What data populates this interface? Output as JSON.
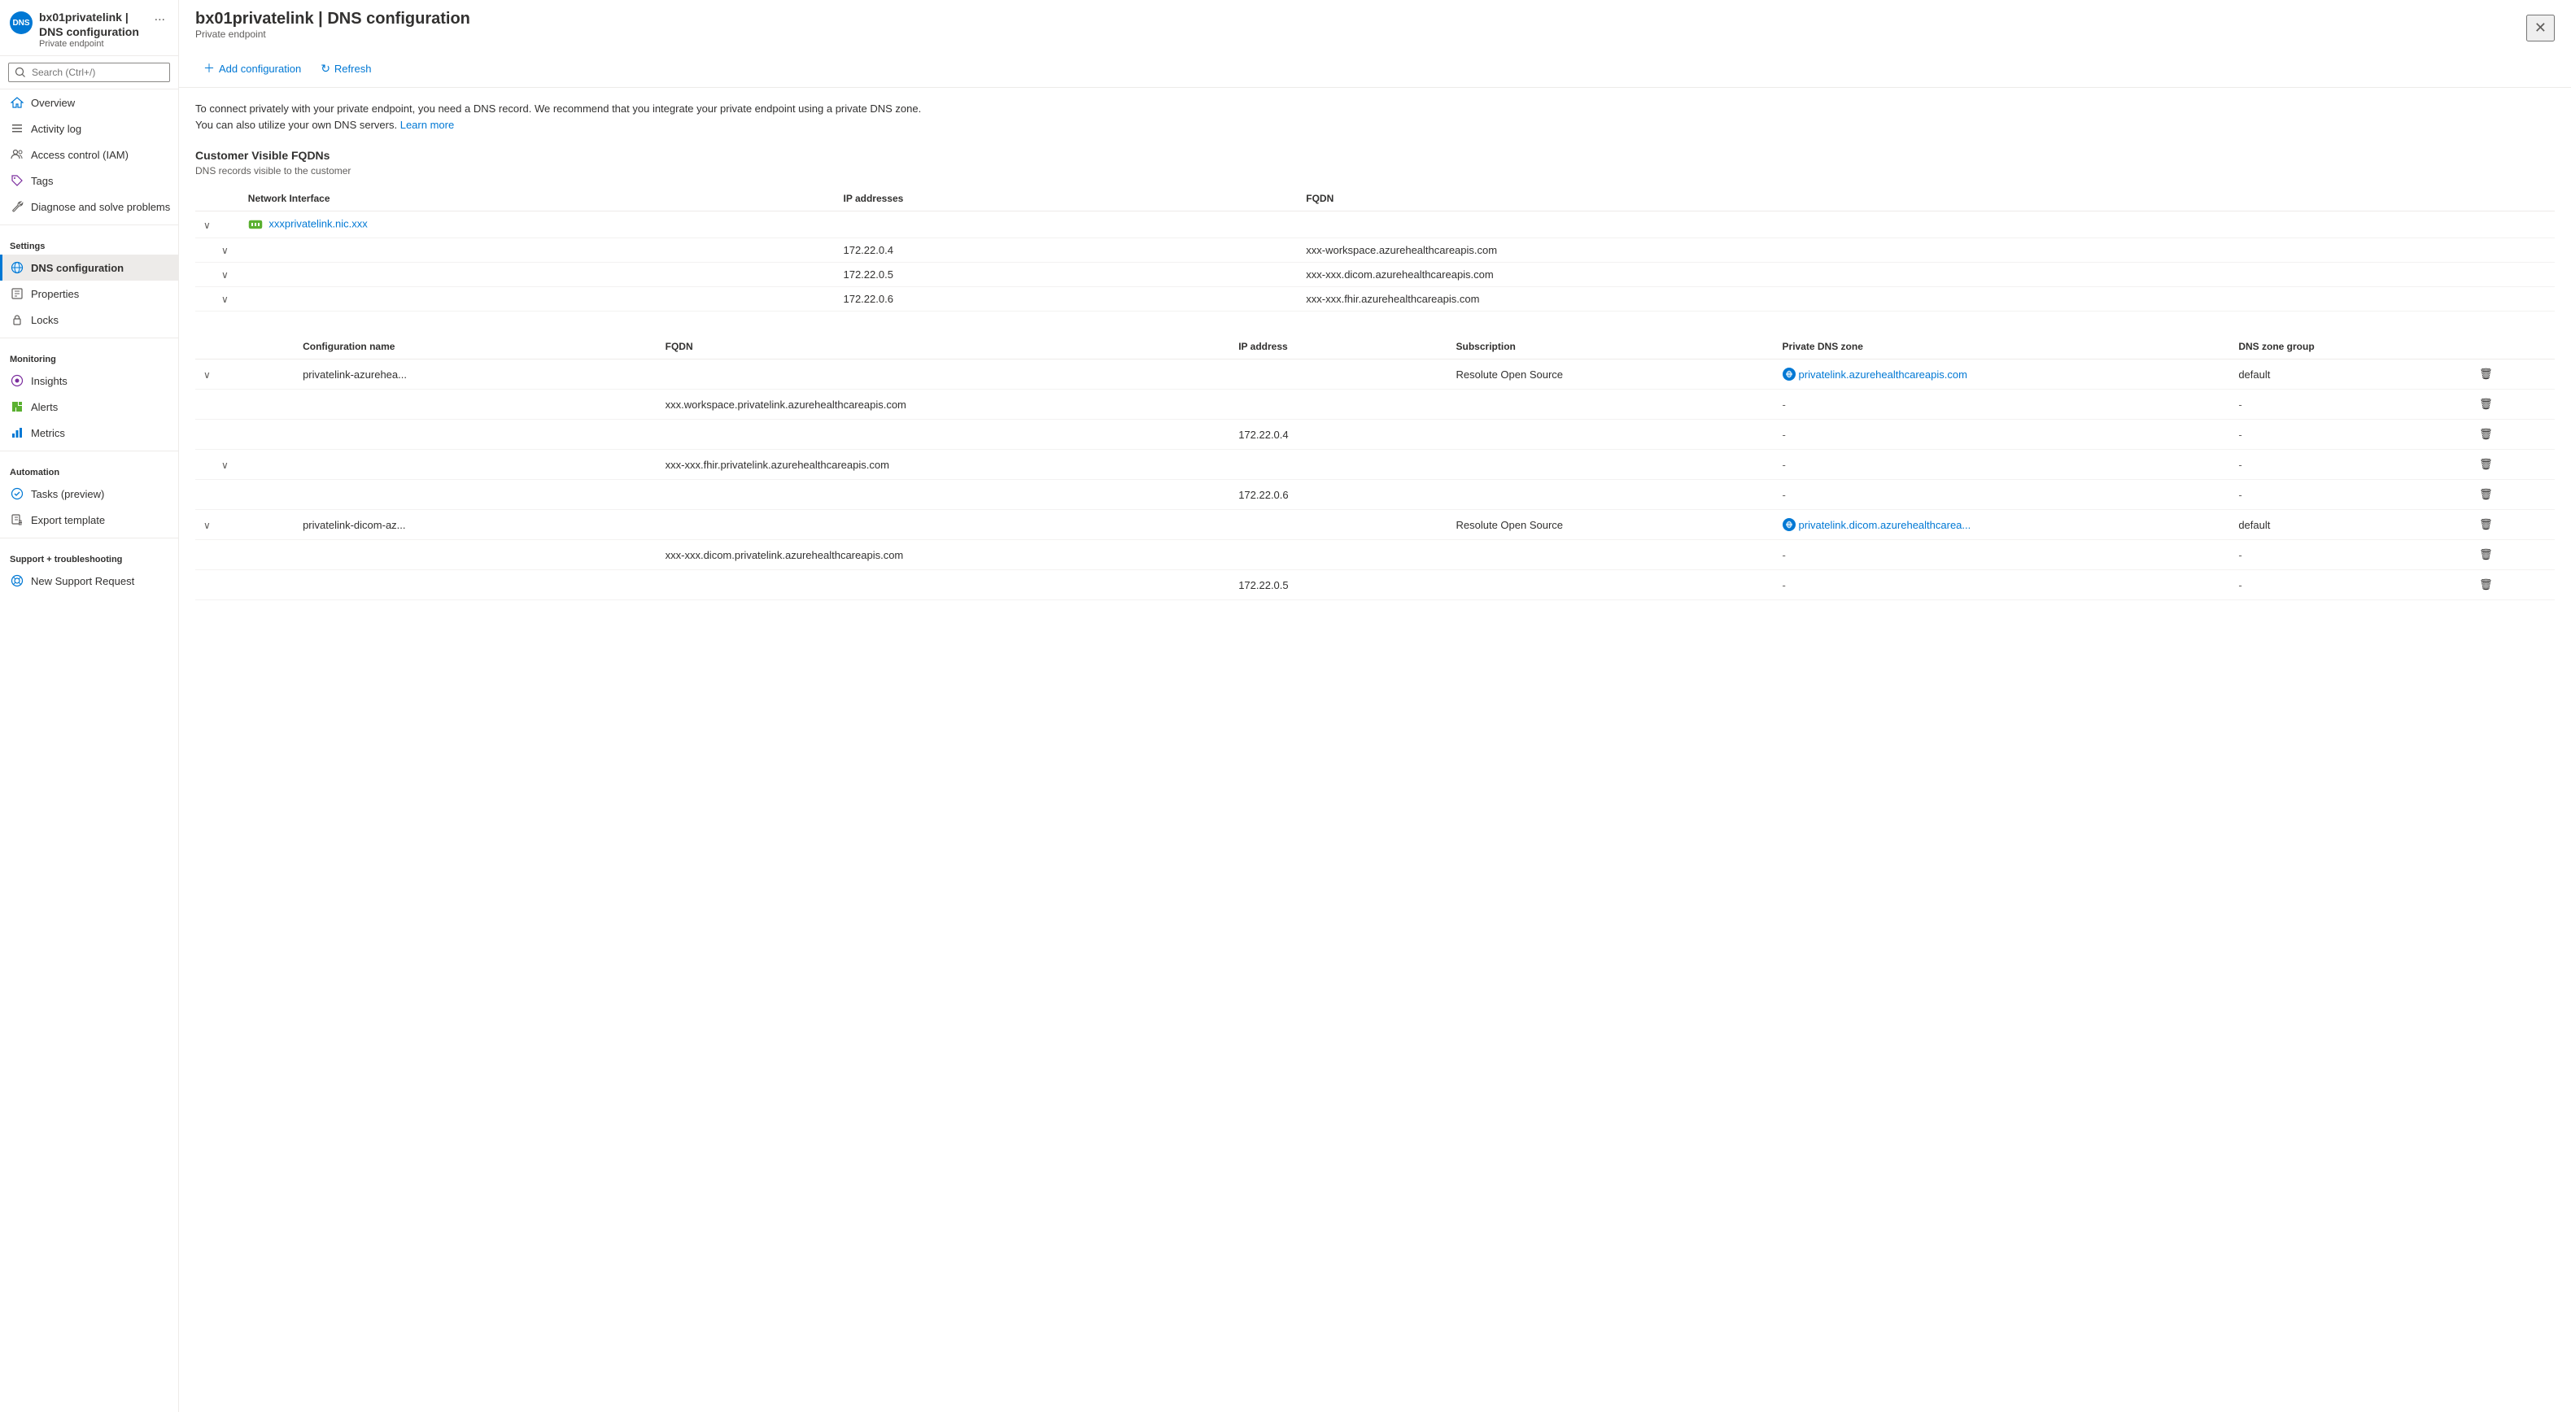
{
  "sidebar": {
    "avatar": "DNS",
    "title": "bx01privatelink | DNS configuration",
    "subtitle": "Private endpoint",
    "more_label": "...",
    "search_placeholder": "Search (Ctrl+/)",
    "collapse_label": "«",
    "nav": [
      {
        "id": "overview",
        "label": "Overview",
        "icon": "home"
      },
      {
        "id": "activity-log",
        "label": "Activity log",
        "icon": "list"
      },
      {
        "id": "access-control",
        "label": "Access control (IAM)",
        "icon": "person-group"
      },
      {
        "id": "tags",
        "label": "Tags",
        "icon": "tag"
      },
      {
        "id": "diagnose",
        "label": "Diagnose and solve problems",
        "icon": "wrench"
      }
    ],
    "settings_label": "Settings",
    "settings_items": [
      {
        "id": "dns-configuration",
        "label": "DNS configuration",
        "icon": "dns",
        "active": true
      },
      {
        "id": "properties",
        "label": "Properties",
        "icon": "properties"
      },
      {
        "id": "locks",
        "label": "Locks",
        "icon": "lock"
      }
    ],
    "monitoring_label": "Monitoring",
    "monitoring_items": [
      {
        "id": "insights",
        "label": "Insights",
        "icon": "insights"
      },
      {
        "id": "alerts",
        "label": "Alerts",
        "icon": "alerts"
      },
      {
        "id": "metrics",
        "label": "Metrics",
        "icon": "metrics"
      }
    ],
    "automation_label": "Automation",
    "automation_items": [
      {
        "id": "tasks",
        "label": "Tasks (preview)",
        "icon": "tasks"
      },
      {
        "id": "export-template",
        "label": "Export template",
        "icon": "export"
      }
    ],
    "support_label": "Support + troubleshooting",
    "support_items": [
      {
        "id": "new-support",
        "label": "New Support Request",
        "icon": "support"
      }
    ]
  },
  "toolbar": {
    "add_label": "Add configuration",
    "refresh_label": "Refresh"
  },
  "info_text": "To connect privately with your private endpoint, you need a DNS record. We recommend that you integrate your private endpoint using a private DNS zone. You can also utilize your own DNS servers.",
  "learn_more_label": "Learn more",
  "customer_fqdns": {
    "title": "Customer Visible FQDNs",
    "subtitle": "DNS records visible to the customer",
    "columns": [
      "Network Interface",
      "IP addresses",
      "FQDN"
    ],
    "rows": [
      {
        "nic_name": "xxxprivatelink.nic.xxx",
        "nic_link": true,
        "expand": true,
        "children": [
          {
            "ip": "172.22.0.4",
            "fqdn": "xxx-workspace.azurehealthcareapis.com",
            "expand": true
          },
          {
            "ip": "172.22.0.5",
            "fqdn": "xxx-xxx.dicom.azurehealthcareapis.com",
            "expand": true
          },
          {
            "ip": "172.22.0.6",
            "fqdn": "xxx-xxx.fhir.azurehealthcareapis.com",
            "expand": true
          }
        ]
      }
    ]
  },
  "config_section": {
    "columns": [
      "Configuration name",
      "FQDN",
      "IP address",
      "Subscription",
      "Private DNS zone",
      "DNS zone group",
      ""
    ],
    "rows": [
      {
        "name": "privatelink-azurehea...",
        "fqdn": "",
        "ip": "",
        "subscription": "Resolute Open Source",
        "dns_zone_label": "privatelink.azurehealthcareapis.com",
        "dns_zone_group": "default",
        "show_delete": true,
        "expand": true,
        "children": [
          {
            "name": "",
            "fqdn": "xxx.workspace.privatelink.azurehealthcareapis.com",
            "ip": "",
            "subscription": "",
            "dns_zone_label": "-",
            "dns_zone_group": "-",
            "show_delete": true
          },
          {
            "name": "",
            "fqdn": "",
            "ip": "172.22.0.4",
            "subscription": "",
            "dns_zone_label": "-",
            "dns_zone_group": "-",
            "show_delete": true
          },
          {
            "name": "",
            "fqdn": "xxx-xxx.fhir.privatelink.azurehealthcareapis.com",
            "ip": "",
            "subscription": "",
            "dns_zone_label": "-",
            "dns_zone_group": "-",
            "show_delete": true,
            "expand": true
          },
          {
            "name": "",
            "fqdn": "",
            "ip": "172.22.0.6",
            "subscription": "",
            "dns_zone_label": "-",
            "dns_zone_group": "-",
            "show_delete": true
          }
        ]
      },
      {
        "name": "privatelink-dicom-az...",
        "fqdn": "",
        "ip": "",
        "subscription": "Resolute Open Source",
        "dns_zone_label": "privatelink.dicom.azurehealthcarea...",
        "dns_zone_group": "default",
        "show_delete": true,
        "expand": true,
        "children": [
          {
            "name": "",
            "fqdn": "xxx-xxx.dicom.privatelink.azurehealthcareapis.com",
            "ip": "",
            "subscription": "",
            "dns_zone_label": "-",
            "dns_zone_group": "-",
            "show_delete": true
          },
          {
            "name": "",
            "fqdn": "",
            "ip": "172.22.0.5",
            "subscription": "",
            "dns_zone_label": "-",
            "dns_zone_group": "-",
            "show_delete": true
          }
        ]
      }
    ]
  },
  "colors": {
    "accent": "#0078d4",
    "active_nav_bg": "#edebe9",
    "active_nav_border": "#0078d4"
  }
}
